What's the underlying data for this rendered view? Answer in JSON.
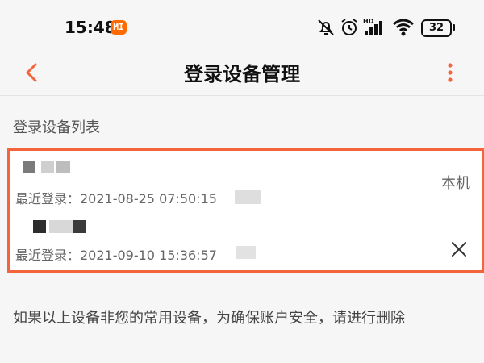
{
  "status_bar": {
    "time": "15:48",
    "mi_badge": "MI",
    "battery": "32",
    "icons": [
      "bell-muted-icon",
      "alarm-icon",
      "hd-signal-icon",
      "wifi-icon",
      "battery-icon"
    ]
  },
  "header": {
    "title": "登录设备管理",
    "back_icon": "chevron-left-icon",
    "more_icon": "more-vertical-icon",
    "accent_color": "#f3643b"
  },
  "section": {
    "label": "登录设备列表"
  },
  "devices": [
    {
      "last_login": "最近登录：2021-08-25 07:50:15",
      "badge": "本机"
    },
    {
      "last_login": "最近登录：2021-09-10 15:36:57",
      "action_icon": "close-icon"
    }
  ],
  "hint": {
    "text": "如果以上设备非您的常用设备，为确保账户安全，请进行删除"
  }
}
